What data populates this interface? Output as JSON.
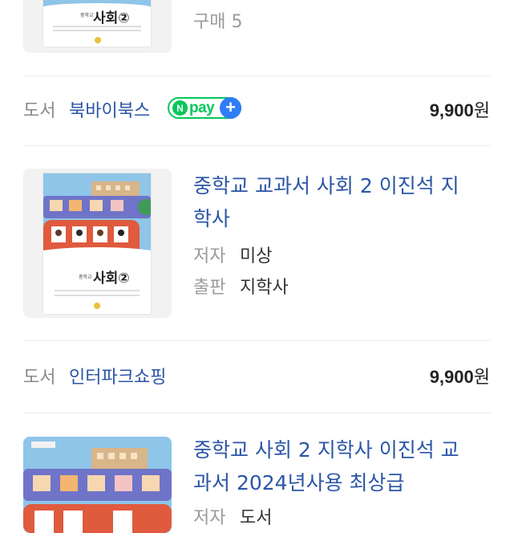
{
  "items": [
    {
      "purchase_label": "구매 5"
    },
    {
      "seller_type": "도서",
      "seller_name": "북바이북스",
      "npay_n": "N",
      "npay_text": "pay",
      "npay_plus": "+",
      "price_number": "9,900",
      "price_unit": "원"
    },
    {
      "title_line1": "중학교 교과서 사회 2 이진석 지",
      "title_line2": "학사",
      "author_label": "저자",
      "author_value": "미상",
      "publisher_label": "출판",
      "publisher_value": "지학사",
      "cover_title": "사회②",
      "cover_school": "중학교",
      "seller_type": "도서",
      "seller_name": "인터파크쇼핑",
      "price_number": "9,900",
      "price_unit": "원"
    },
    {
      "title_line1": "중학교 사회 2 지학사 이진석 교",
      "title_line2": "과서 2024년사용 최상급",
      "author_label": "저자",
      "author_value": "도서"
    }
  ],
  "colors": {
    "link_blue": "#2b55a6",
    "npay_green": "#03c75a",
    "npay_blue": "#2f7df6",
    "divider": "#ebebeb"
  }
}
